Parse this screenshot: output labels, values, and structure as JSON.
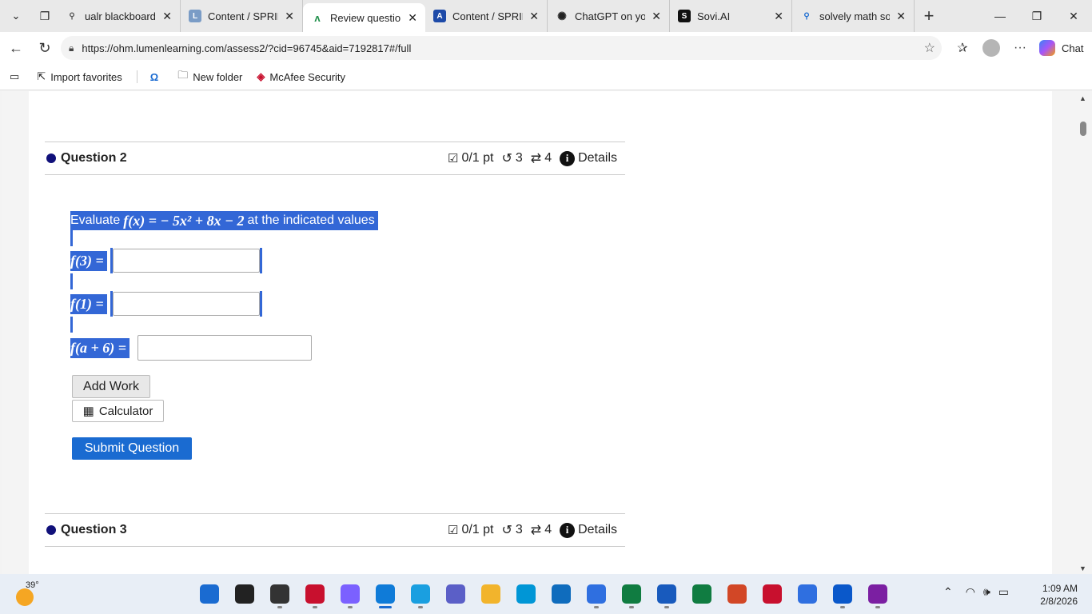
{
  "tabs": [
    {
      "title": "ualr blackboard - S",
      "icon": "search-icon",
      "color": "#e9e9e9"
    },
    {
      "title": "Content / SPRING",
      "icon": "lumen-icon",
      "color": "#7a9cc6"
    },
    {
      "title": "Review questions",
      "icon": "ohm-icon",
      "color": "#ffffff"
    },
    {
      "title": "Content / SPRING",
      "icon": "canvas-icon",
      "color": "#1d4aa8"
    },
    {
      "title": "ChatGPT on your",
      "icon": "chatgpt-icon",
      "color": "#e9e9e9"
    },
    {
      "title": "Sovi.AI",
      "icon": "sovi-icon",
      "color": "#111111"
    },
    {
      "title": "solvely math solve",
      "icon": "search-icon",
      "color": "#e9e9e9"
    }
  ],
  "address": {
    "url": "https://ohm.lumenlearning.com/assess2/?cid=96745&aid=7192817#/full"
  },
  "toolbar": {
    "chat_label": "Chat"
  },
  "favorites": [
    {
      "label": "Import favorites",
      "icon": "import-icon"
    },
    {
      "label": "",
      "icon": "omega-icon"
    },
    {
      "label": "New folder",
      "icon": "folder-icon"
    },
    {
      "label": "McAfee Security",
      "icon": "mcafee-icon"
    }
  ],
  "question2": {
    "title": "Question 2",
    "points": "0/1 pt",
    "retries": "3",
    "attempts": "4",
    "details": "Details",
    "prompt_prefix": "Evaluate",
    "function": "f(x) = − 5x² + 8x − 2",
    "prompt_suffix": "at the indicated values",
    "parts": [
      {
        "label": "f(3) =",
        "value": ""
      },
      {
        "label": "f(1) =",
        "value": ""
      },
      {
        "label": "f(a + 6) =",
        "value": ""
      }
    ],
    "add_work": "Add Work",
    "calculator": "Calculator",
    "submit": "Submit Question"
  },
  "question3": {
    "title": "Question 3",
    "points": "0/1 pt",
    "retries": "3",
    "attempts": "4",
    "details": "Details"
  },
  "taskbar": {
    "temperature": "39°",
    "time": "1:09 AM",
    "date": "2/8/2026",
    "apps": [
      {
        "name": "windows-start-icon",
        "color": "#1a6bd1"
      },
      {
        "name": "search-icon",
        "color": "#222222"
      },
      {
        "name": "file-manager-icon",
        "color": "#333333"
      },
      {
        "name": "mcafee-icon",
        "color": "#c8102e"
      },
      {
        "name": "copilot-icon",
        "color": "#7b61ff"
      },
      {
        "name": "edge-icon",
        "color": "#0f7bd8"
      },
      {
        "name": "help-icon",
        "color": "#1a9fe0"
      },
      {
        "name": "teams-icon",
        "color": "#5b5fc7"
      },
      {
        "name": "explorer-folder-icon",
        "color": "#f2b42c"
      },
      {
        "name": "hp-icon",
        "color": "#0096d6"
      },
      {
        "name": "outlook-icon",
        "color": "#0f6cbd"
      },
      {
        "name": "app-icon",
        "color": "#2f6fe0"
      },
      {
        "name": "app-green-icon",
        "color": "#107c41"
      },
      {
        "name": "word-icon",
        "color": "#185abd"
      },
      {
        "name": "excel-icon",
        "color": "#107c41"
      },
      {
        "name": "powerpoint-icon",
        "color": "#d24726"
      },
      {
        "name": "news-icon",
        "color": "#c8102e"
      },
      {
        "name": "store-icon",
        "color": "#2f6fe0"
      },
      {
        "name": "sovi-icon",
        "color": "#0a58ca"
      },
      {
        "name": "tubi-icon",
        "color": "#7b1fa2"
      }
    ]
  }
}
